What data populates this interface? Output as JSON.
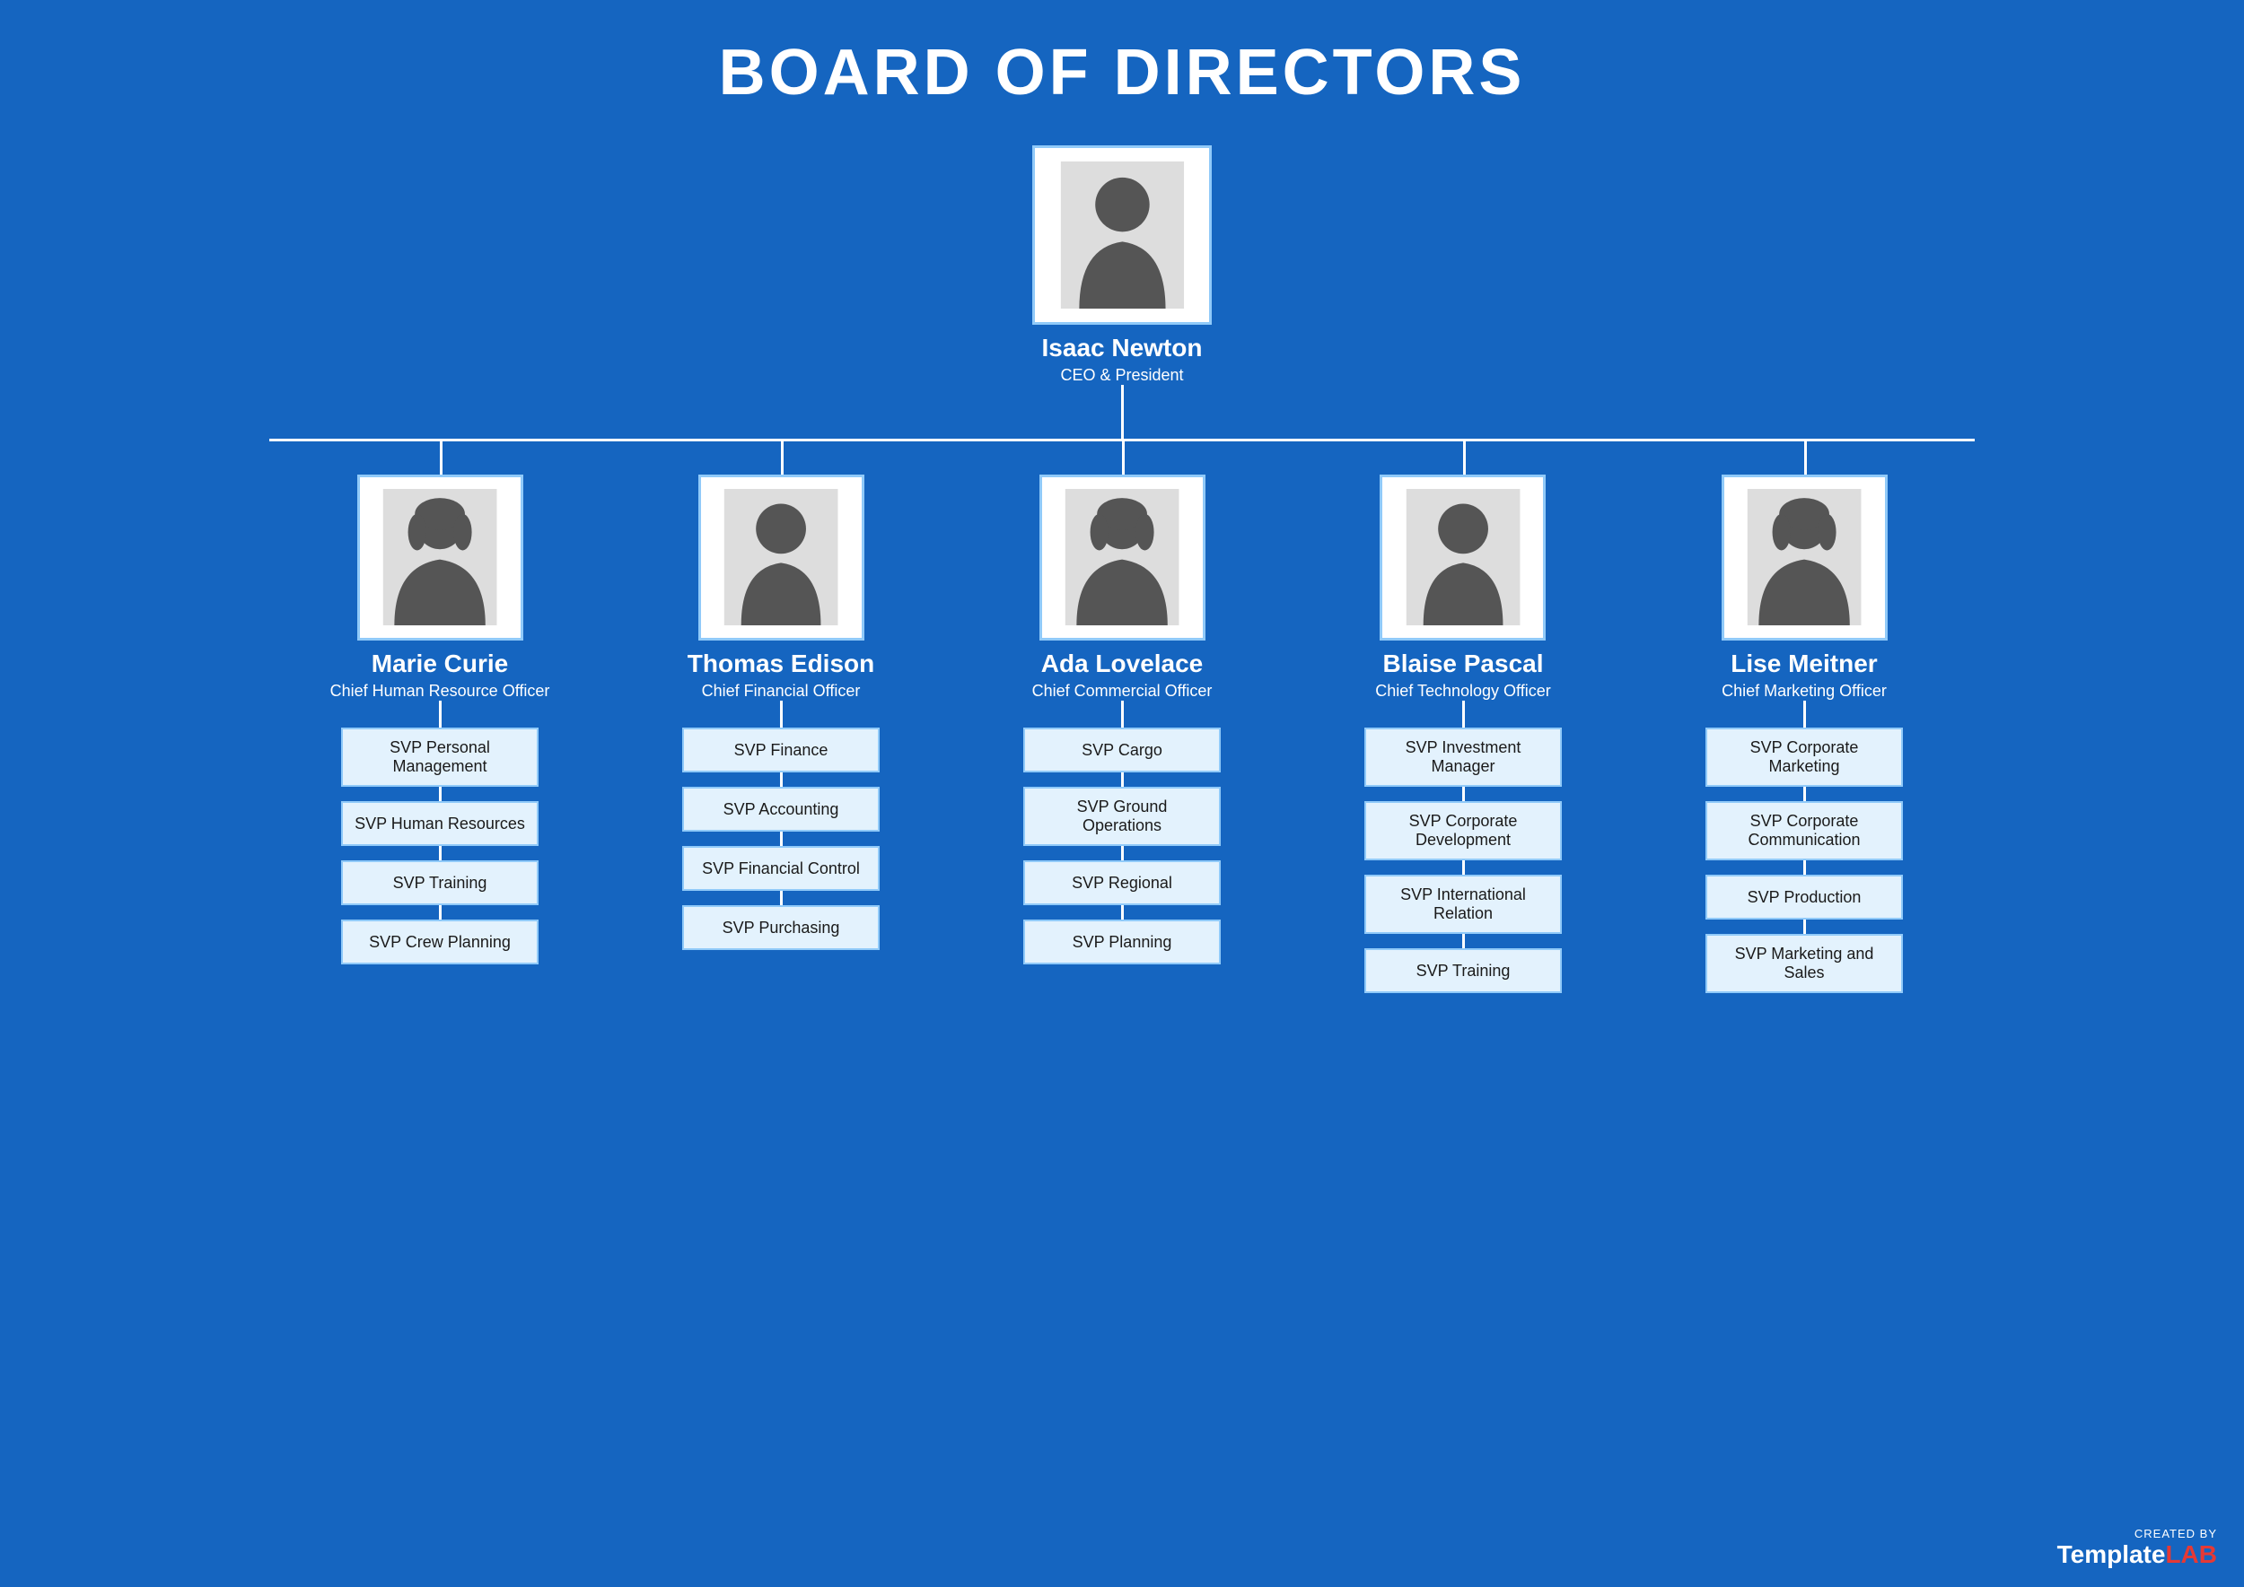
{
  "title": "BOARD OF DIRECTORS",
  "ceo": {
    "name": "Isaac Newton",
    "role": "CEO & President",
    "gender": "male"
  },
  "directors": [
    {
      "name": "Marie Curie",
      "role": "Chief Human Resource Officer",
      "gender": "female",
      "svps": [
        "SVP Personal Management",
        "SVP Human Resources",
        "SVP Training",
        "SVP Crew Planning"
      ]
    },
    {
      "name": "Thomas Edison",
      "role": "Chief Financial Officer",
      "gender": "male",
      "svps": [
        "SVP Finance",
        "SVP Accounting",
        "SVP Financial Control",
        "SVP Purchasing"
      ]
    },
    {
      "name": "Ada Lovelace",
      "role": "Chief Commercial Officer",
      "gender": "female",
      "svps": [
        "SVP Cargo",
        "SVP Ground Operations",
        "SVP Regional",
        "SVP Planning"
      ]
    },
    {
      "name": "Blaise Pascal",
      "role": "Chief Technology Officer",
      "gender": "male",
      "svps": [
        "SVP Investment Manager",
        "SVP Corporate Development",
        "SVP International Relation",
        "SVP Training"
      ]
    },
    {
      "name": "Lise Meitner",
      "role": "Chief Marketing Officer",
      "gender": "female",
      "svps": [
        "SVP Corporate Marketing",
        "SVP Corporate Communication",
        "SVP Production",
        "SVP Marketing and Sales"
      ]
    }
  ],
  "watermark": {
    "created_by": "CREATED BY",
    "brand_template": "Template",
    "brand_lab": "LAB"
  }
}
